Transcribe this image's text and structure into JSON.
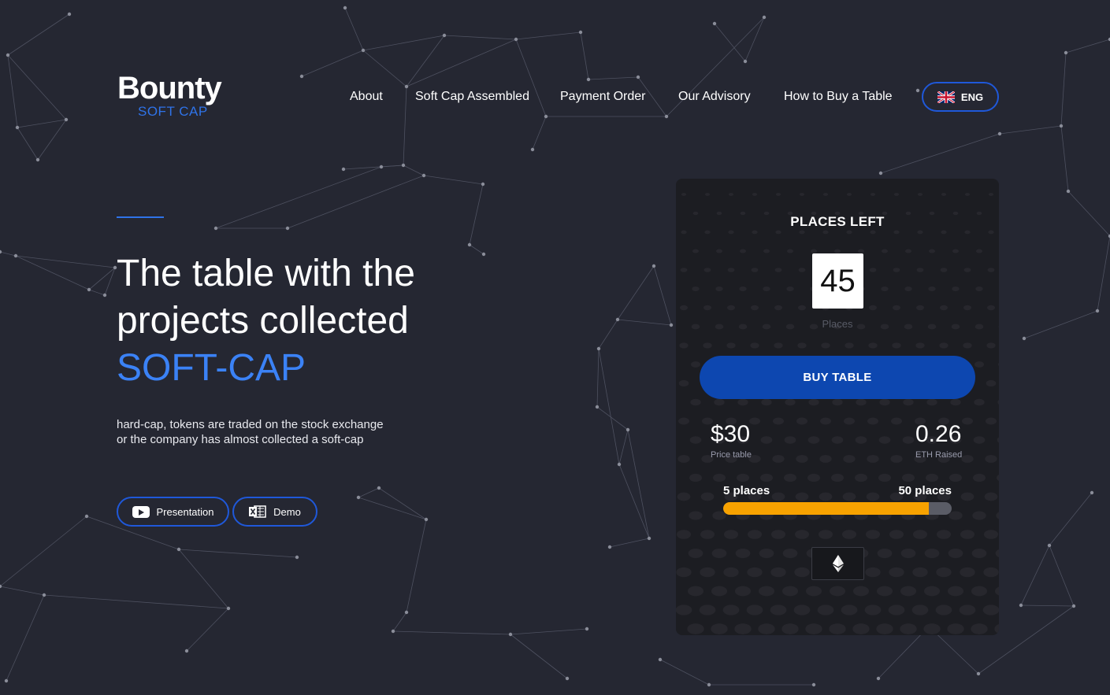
{
  "logo": {
    "title": "Bounty",
    "subtitle": "SOFT CAP"
  },
  "nav": {
    "items": [
      {
        "label": "About"
      },
      {
        "label": "Soft Cap Assembled"
      },
      {
        "label": "Payment Order"
      },
      {
        "label": "Our Advisory"
      },
      {
        "label": "How to Buy a Table"
      }
    ],
    "language": {
      "label": "ENG",
      "icon": "uk-flag-icon"
    }
  },
  "hero": {
    "title_line1": "The table with the",
    "title_line2": "projects collected",
    "title_accent": "SOFT-CAP",
    "description": "hard-cap, tokens are traded on the stock exchange or the company has almost collected a soft-cap",
    "buttons": {
      "presentation": {
        "label": "Presentation",
        "icon": "youtube-icon"
      },
      "demo": {
        "label": "Demo",
        "icon": "excel-icon"
      }
    }
  },
  "card": {
    "heading": "PLACES LEFT",
    "places_count": "45",
    "places_label": "Places",
    "buy_label": "BUY TABLE",
    "price": {
      "value": "$30",
      "label": "Price table"
    },
    "raised": {
      "value": "0.26",
      "label": "ETH Raised"
    },
    "range": {
      "min_label": "5 places",
      "max_label": "50 places"
    },
    "progress_fraction": 0.9,
    "currency_icon": "ethereum-icon"
  },
  "colors": {
    "background": "#252732",
    "accent_blue": "#3b82f6",
    "button_blue": "#0d47b0",
    "progress_orange": "#f7a200"
  }
}
